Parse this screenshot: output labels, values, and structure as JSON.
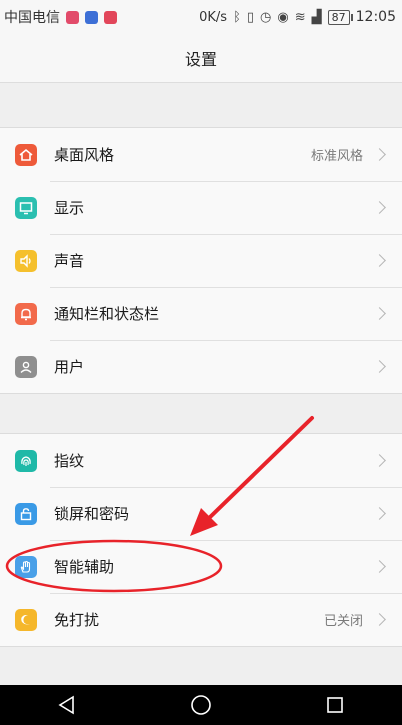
{
  "statusbar": {
    "carrier": "中国电信",
    "speed": "0K/s",
    "battery": "87",
    "time": "12:05",
    "app_icon_colors": [
      "#e24b6a",
      "#3d6fd6",
      "#e2465a"
    ]
  },
  "title": "设置",
  "sections": [
    {
      "items": [
        {
          "label": "桌面风格",
          "value": "标准风格",
          "icon": "home-icon",
          "color": "#ee5a3a"
        },
        {
          "label": "显示",
          "value": "",
          "icon": "display-icon",
          "color": "#2bbfb0"
        },
        {
          "label": "声音",
          "value": "",
          "icon": "sound-icon",
          "color": "#f5c02d"
        },
        {
          "label": "通知栏和状态栏",
          "value": "",
          "icon": "bell-icon",
          "color": "#f26a4b"
        },
        {
          "label": "用户",
          "value": "",
          "icon": "user-icon",
          "color": "#8f8f8f"
        }
      ]
    },
    {
      "items": [
        {
          "label": "指纹",
          "value": "",
          "icon": "fingerprint-icon",
          "color": "#1fb9a8"
        },
        {
          "label": "锁屏和密码",
          "value": "",
          "icon": "lock-icon",
          "color": "#3a9ae6"
        },
        {
          "label": "智能辅助",
          "value": "",
          "icon": "hand-icon",
          "color": "#4aa0e8"
        },
        {
          "label": "免打扰",
          "value": "已关闭",
          "icon": "moon-icon",
          "color": "#f5b72b"
        }
      ]
    }
  ],
  "annotation_color": "#e8232a"
}
